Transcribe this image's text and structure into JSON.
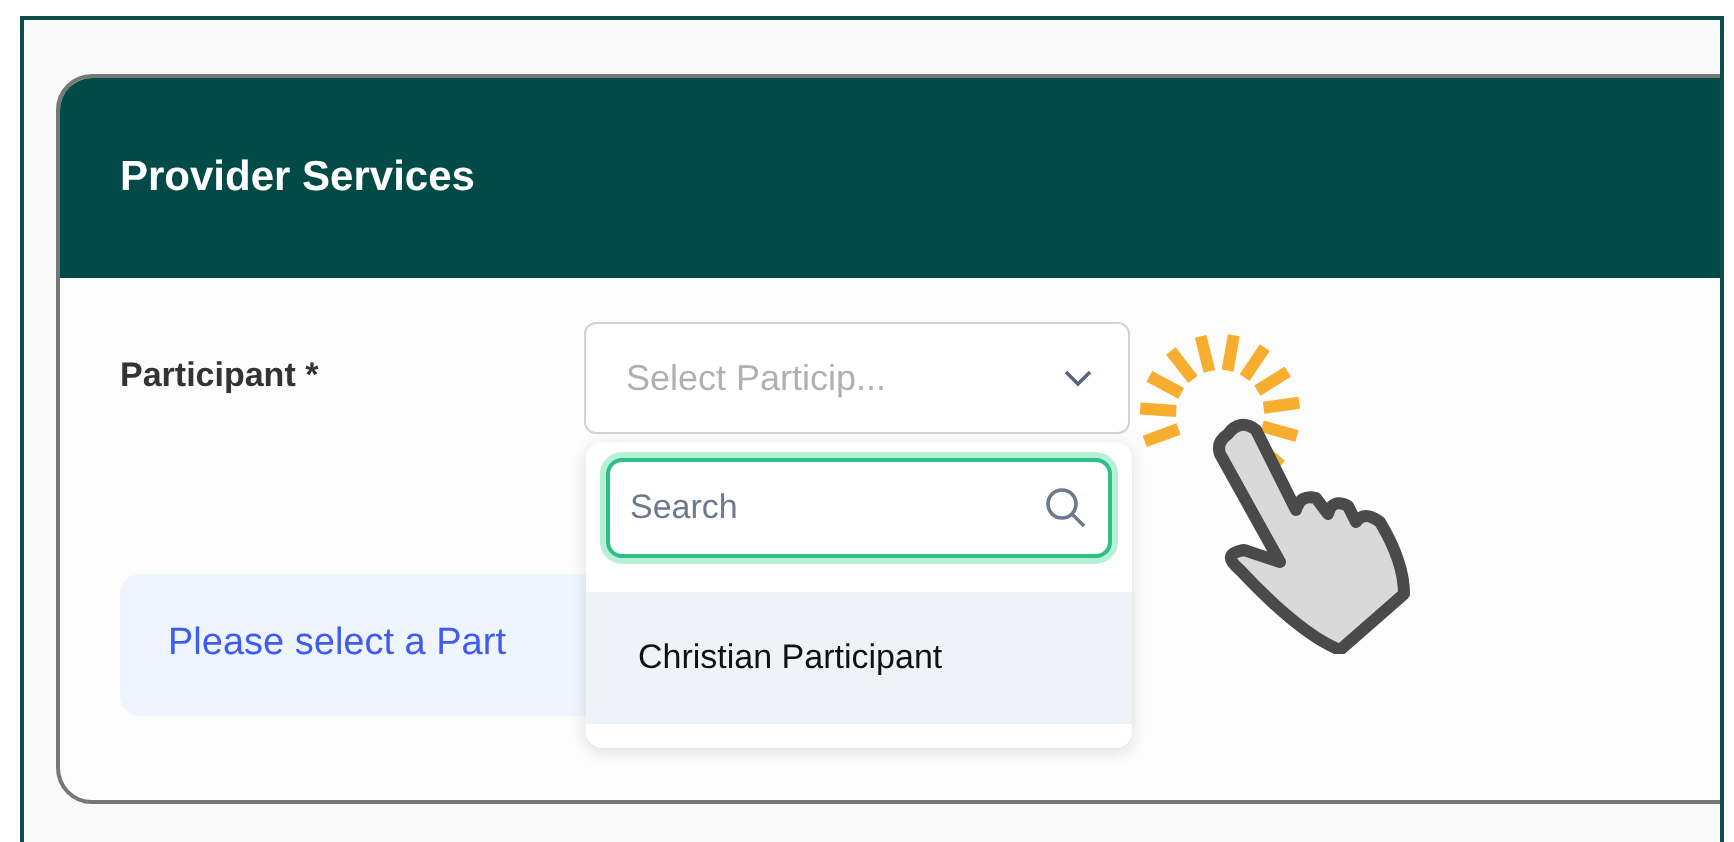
{
  "card": {
    "title": "Provider Services"
  },
  "form": {
    "label": "Participant *",
    "select": {
      "placeholder": "Select Particip...",
      "expanded": true
    }
  },
  "dropdown": {
    "search": {
      "placeholder": "Search",
      "focused": true
    },
    "options": [
      {
        "label": "Christian Participant",
        "highlighted": true
      }
    ]
  },
  "notice": {
    "text": "Please select a Part"
  }
}
